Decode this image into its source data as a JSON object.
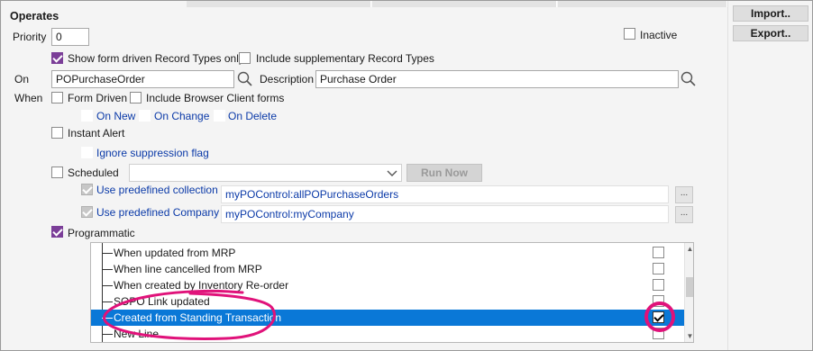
{
  "section": {
    "title": "Operates"
  },
  "priority": {
    "label": "Priority",
    "value": "0"
  },
  "inactive": {
    "label": "Inactive",
    "checked": false
  },
  "side_buttons": {
    "import": "Import..",
    "export": "Export.."
  },
  "options": {
    "show_form_driven": {
      "label": "Show form driven Record Types only",
      "checked": true
    },
    "include_supplementary": {
      "label": "Include supplementary Record Types",
      "checked": false
    }
  },
  "on": {
    "label": "On",
    "value": "POPurchaseOrder"
  },
  "description": {
    "label": "Description",
    "value": "Purchase Order"
  },
  "when": {
    "label": "When",
    "form_driven": {
      "label": "Form Driven",
      "checked": false
    },
    "include_browser": {
      "label": "Include Browser Client forms",
      "checked": false
    },
    "on_new": "On New",
    "on_change": "On Change",
    "on_delete": "On Delete",
    "instant_alert": {
      "label": "Instant Alert",
      "checked": false
    },
    "ignore_suppression": "Ignore suppression flag",
    "scheduled": {
      "label": "Scheduled",
      "checked": false
    },
    "run_now": "Run Now",
    "use_collection": {
      "label": "Use predefined collection",
      "value": "myPOControl:allPOPurchaseOrders"
    },
    "use_company": {
      "label": "Use predefined Company",
      "value": "myPOControl:myCompany"
    },
    "ellipsis": "...",
    "programmatic": {
      "label": "Programmatic",
      "checked": true
    }
  },
  "programmatic_list": {
    "items": [
      {
        "label": "When updated from MRP",
        "checked": false,
        "selected": false
      },
      {
        "label": "When line cancelled from MRP",
        "checked": false,
        "selected": false
      },
      {
        "label": "When created by Inventory Re-order",
        "checked": false,
        "selected": false
      },
      {
        "label": "SOPO Link updated",
        "checked": false,
        "selected": false
      },
      {
        "label": "Created from Standing Transaction",
        "checked": true,
        "selected": true
      },
      {
        "label": "New Line",
        "checked": false,
        "selected": false
      }
    ]
  },
  "colors": {
    "accent_checkbox": "#7b3e98",
    "selection": "#0a78d7",
    "link_blue": "#0b3aa8",
    "annotation": "#e0127a"
  },
  "icons": {
    "on_search": "magnifier-icon",
    "description_search": "magnifier-icon",
    "combo_arrow": "chevron-down-icon"
  }
}
